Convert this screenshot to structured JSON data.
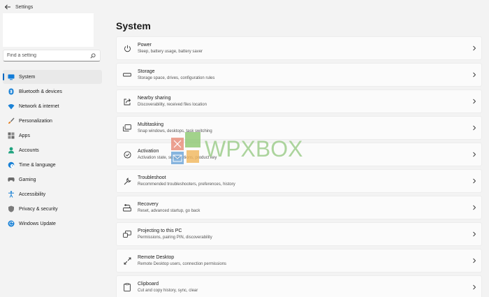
{
  "app": {
    "title": "Settings",
    "back_icon": "back-arrow-icon"
  },
  "search": {
    "placeholder": "Find a setting",
    "icon": "search-icon"
  },
  "sidebar": {
    "items": [
      {
        "label": "System",
        "icon": "system-icon",
        "active": true,
        "color": "#0f7bd8"
      },
      {
        "label": "Bluetooth & devices",
        "icon": "bluetooth-icon",
        "color": "#1b82d6"
      },
      {
        "label": "Network & internet",
        "icon": "wifi-icon",
        "color": "#1b82d6"
      },
      {
        "label": "Personalization",
        "icon": "brush-icon",
        "color": "#e47b1c"
      },
      {
        "label": "Apps",
        "icon": "apps-icon",
        "color": "#6b6b6b"
      },
      {
        "label": "Accounts",
        "icon": "person-icon",
        "color": "#1fa37f"
      },
      {
        "label": "Time & language",
        "icon": "globe-clock-icon",
        "color": "#1b82d6"
      },
      {
        "label": "Gaming",
        "icon": "gamepad-icon",
        "color": "#6b6b6b"
      },
      {
        "label": "Accessibility",
        "icon": "accessibility-icon",
        "color": "#1b82d6"
      },
      {
        "label": "Privacy & security",
        "icon": "shield-icon",
        "color": "#7a7a7a"
      },
      {
        "label": "Windows Update",
        "icon": "update-icon",
        "color": "#1b82d6"
      }
    ]
  },
  "main": {
    "title": "System",
    "cards": [
      {
        "title": "Power",
        "desc": "Sleep, battery usage, battery saver",
        "icon": "power-icon"
      },
      {
        "title": "Storage",
        "desc": "Storage space, drives, configuration rules",
        "icon": "storage-icon"
      },
      {
        "title": "Nearby sharing",
        "desc": "Discoverability, received files location",
        "icon": "share-icon"
      },
      {
        "title": "Multitasking",
        "desc": "Snap windows, desktops, task switching",
        "icon": "multitasking-icon"
      },
      {
        "title": "Activation",
        "desc": "Activation state, subscriptions, product key",
        "icon": "activation-icon"
      },
      {
        "title": "Troubleshoot",
        "desc": "Recommended troubleshooters, preferences, history",
        "icon": "wrench-icon"
      },
      {
        "title": "Recovery",
        "desc": "Reset, advanced startup, go back",
        "icon": "recovery-icon"
      },
      {
        "title": "Projecting to this PC",
        "desc": "Permissions, pairing PIN, discoverability",
        "icon": "projecting-icon"
      },
      {
        "title": "Remote Desktop",
        "desc": "Remote Desktop users, connection permissions",
        "icon": "remote-desktop-icon"
      },
      {
        "title": "Clipboard",
        "desc": "Cut and copy history, sync, clear",
        "icon": "clipboard-icon"
      }
    ]
  },
  "watermark": {
    "text": "WPXBOX"
  }
}
